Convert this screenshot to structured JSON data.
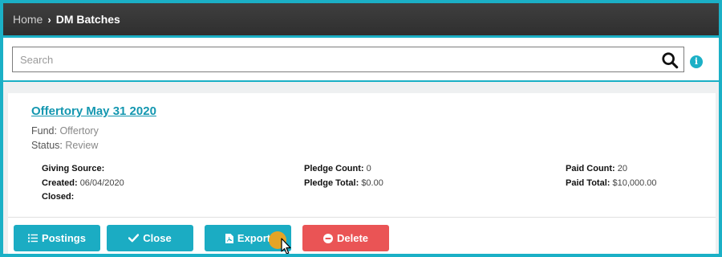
{
  "breadcrumb": {
    "home": "Home",
    "separator": "›",
    "current": "DM Batches"
  },
  "search": {
    "placeholder": "Search",
    "value": ""
  },
  "batch": {
    "title": "Offertory May 31 2020",
    "fund_label": "Fund:",
    "fund_value": "Offertory",
    "status_label": "Status:",
    "status_value": "Review",
    "details": {
      "giving_source_label": "Giving Source:",
      "giving_source_value": "",
      "created_label": "Created:",
      "created_value": "06/04/2020",
      "closed_label": "Closed:",
      "closed_value": "",
      "pledge_count_label": "Pledge Count:",
      "pledge_count_value": "0",
      "pledge_total_label": "Pledge Total:",
      "pledge_total_value": "$0.00",
      "paid_count_label": "Paid Count:",
      "paid_count_value": "20",
      "paid_total_label": "Paid Total:",
      "paid_total_value": "$10,000.00"
    }
  },
  "actions": {
    "postings_label": "Postings",
    "close_label": "Close",
    "export_label": "Export",
    "delete_label": "Delete"
  },
  "colors": {
    "accent": "#1bacc3",
    "danger": "#ea5455",
    "topbar": "#333333"
  },
  "icons": {
    "breadcrumb_separator": "chevron-right-icon",
    "search": "search-icon",
    "info": "info-icon",
    "postings": "list-icon",
    "close": "check-icon",
    "export": "pdf-file-icon",
    "delete": "minus-circle-icon"
  }
}
